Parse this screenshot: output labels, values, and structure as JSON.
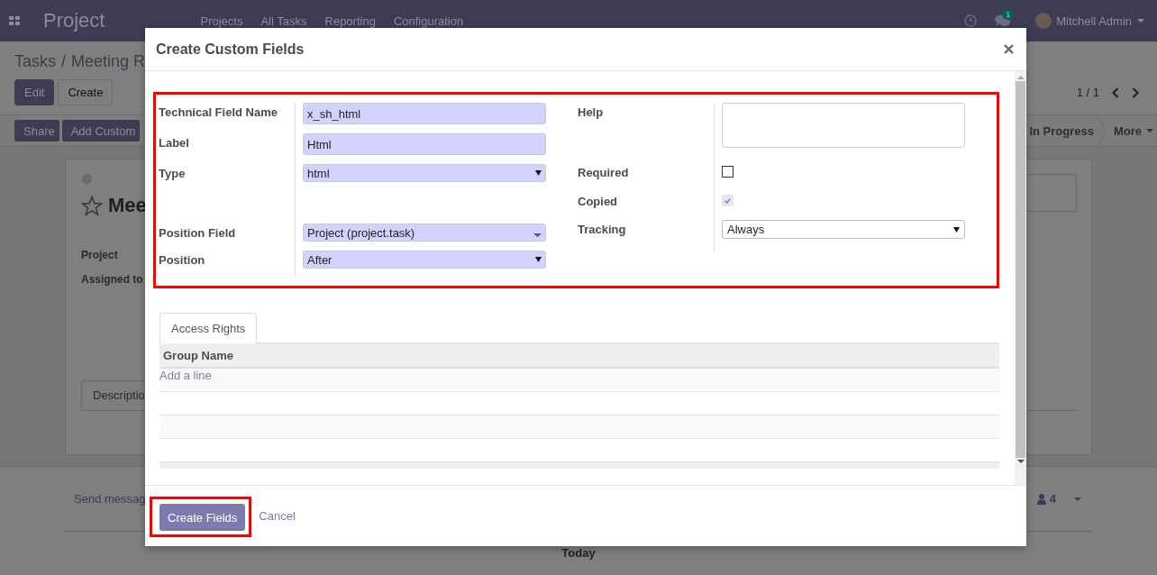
{
  "navbar": {
    "app_name": "Project",
    "menu": [
      "Projects",
      "All Tasks",
      "Reporting",
      "Configuration"
    ],
    "message_badge": "1",
    "user": "Mitchell Admin"
  },
  "breadcrumb": {
    "parent": "Tasks",
    "separator": "/",
    "current": "Meeting R"
  },
  "control_panel": {
    "buttons": [
      "Edit",
      "Create"
    ],
    "pager": "1 / 1"
  },
  "statusbar": {
    "buttons": [
      "Share",
      "Add Custom"
    ],
    "stage": "In Progress",
    "more": "More"
  },
  "form": {
    "title": "Mee",
    "fields": [
      "Project",
      "Assigned to"
    ],
    "tab": "Descriptio"
  },
  "chatter": {
    "send_message": "Send messag",
    "followers": "4",
    "date_separator": "Today"
  },
  "dialog": {
    "title": "Create Custom Fields",
    "highlight_fields": true,
    "left_fields": [
      {
        "label": "Technical Field Name",
        "kind": "text",
        "value": "x_sh_html"
      },
      {
        "label": "Label",
        "kind": "text",
        "value": "Html"
      },
      {
        "label": "Type",
        "kind": "select",
        "value": "html"
      },
      {
        "label": "Position Field",
        "kind": "many2one",
        "value": "Project (project.task)"
      },
      {
        "label": "Position",
        "kind": "select",
        "value": "After"
      }
    ],
    "right_fields": [
      {
        "label": "Help",
        "kind": "textarea"
      },
      {
        "label": "Required",
        "kind": "checkbox",
        "checked": false,
        "disabled": false
      },
      {
        "label": "Copied",
        "kind": "checkbox",
        "checked": true,
        "disabled": true
      },
      {
        "label": "Tracking",
        "kind": "plain_select",
        "value": "Always"
      }
    ],
    "tabs": [
      {
        "label": "Access Rights",
        "selected": true
      }
    ],
    "table": {
      "columns": [
        "Group Name"
      ],
      "add_line": "Add a line"
    },
    "create_button": {
      "label": "Create Fields",
      "highlighted": true
    },
    "cancel": "Cancel"
  }
}
